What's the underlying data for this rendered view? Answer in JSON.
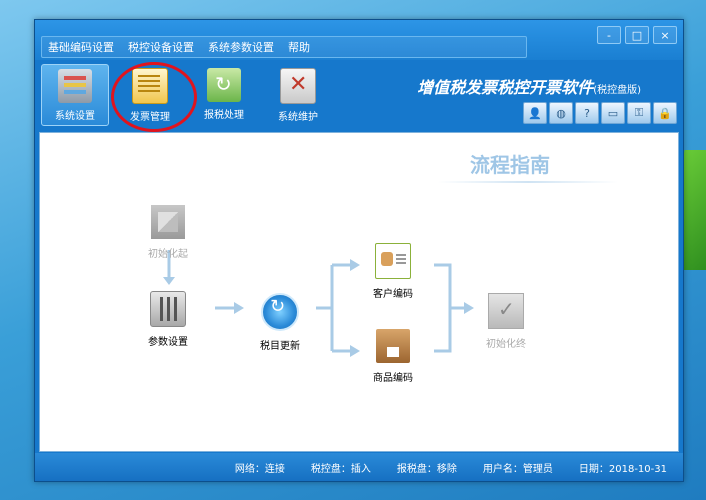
{
  "menu": [
    "基础编码设置",
    "税控设备设置",
    "系统参数设置",
    "帮助"
  ],
  "window_controls": [
    "-",
    "□",
    "×"
  ],
  "toolbar": [
    {
      "label": "系统设置",
      "icon": "system-settings-icon"
    },
    {
      "label": "发票管理",
      "icon": "invoice-management-icon"
    },
    {
      "label": "报税处理",
      "icon": "tax-report-icon"
    },
    {
      "label": "系统维护",
      "icon": "system-maintenance-icon"
    }
  ],
  "app": {
    "title": "增值税发票税控开票软件",
    "subtitle": "(税控盘版)"
  },
  "small_icons": [
    "user-icon",
    "globe-icon",
    "help-icon",
    "window-icon",
    "key-icon",
    "lock-icon"
  ],
  "guide": {
    "title": "流程指南",
    "steps": {
      "init_start": "初始化起",
      "param_setting": "参数设置",
      "tax_update": "税目更新",
      "customer_code": "客户编码",
      "goods_code": "商品编码",
      "init_end": "初始化终"
    }
  },
  "status": {
    "network": "网络：连接",
    "tax_disk": "税控盘：插入",
    "report_disk": "报税盘：移除",
    "user": "用户名：管理员",
    "date": "日期：2018-10-31"
  },
  "colors": {
    "accent": "#1678cc",
    "highlight": "#e0141e",
    "guide": "#9fc6e6"
  }
}
